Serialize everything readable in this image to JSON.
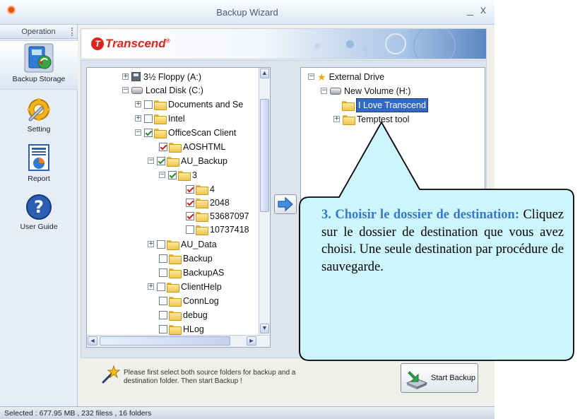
{
  "window": {
    "title": "Backup Wizard",
    "minimize": "_",
    "close": "x"
  },
  "sidebar": {
    "header": "Operation",
    "items": [
      {
        "label": "Backup Storage",
        "icon": "backup-storage-icon"
      },
      {
        "label": "Setting",
        "icon": "wrench-gear-icon"
      },
      {
        "label": "Report",
        "icon": "report-icon"
      },
      {
        "label": "User Guide",
        "icon": "help-icon"
      }
    ]
  },
  "banner": {
    "brand": "Transcend",
    "reg": "®"
  },
  "source_tree": [
    {
      "label": "3½ Floppy (A:)",
      "type": "floppy",
      "expander": "+"
    },
    {
      "label": "Local Disk (C:)",
      "type": "disk",
      "expander": "−"
    },
    {
      "label": "Documents and Se",
      "type": "folder",
      "expander": "+",
      "checked": false
    },
    {
      "label": "Intel",
      "type": "folder",
      "expander": "+",
      "checked": false
    },
    {
      "label": "OfficeScan Client",
      "type": "folder",
      "expander": "−",
      "checked": true
    },
    {
      "label": "AOSHTML",
      "type": "folder",
      "checked": true,
      "check_color": "red"
    },
    {
      "label": "AU_Backup",
      "type": "folder",
      "expander": "−",
      "checked": true
    },
    {
      "label": "3",
      "type": "folder",
      "expander": "−",
      "checked": true
    },
    {
      "label": "4",
      "type": "folder",
      "checked": true,
      "check_color": "red"
    },
    {
      "label": "2048",
      "type": "folder",
      "checked": true,
      "check_color": "red"
    },
    {
      "label": "53687097",
      "type": "folder",
      "checked": true,
      "check_color": "red"
    },
    {
      "label": "10737418",
      "type": "folder",
      "checked": false
    },
    {
      "label": "AU_Data",
      "type": "folder",
      "expander": "+",
      "checked": false
    },
    {
      "label": "Backup",
      "type": "folder",
      "checked": false
    },
    {
      "label": "BackupAS",
      "type": "folder",
      "checked": false
    },
    {
      "label": "ClientHelp",
      "type": "folder",
      "expander": "+",
      "checked": false
    },
    {
      "label": "ConnLog",
      "type": "folder",
      "checked": false
    },
    {
      "label": "debug",
      "type": "folder",
      "checked": false
    },
    {
      "label": "HLog",
      "type": "folder",
      "checked": false
    }
  ],
  "dest_tree": [
    {
      "label": "External Drive",
      "type": "star",
      "expander": "−"
    },
    {
      "label": "New Volume (H:)",
      "type": "disk",
      "expander": "−"
    },
    {
      "label": "I Love Transcend",
      "type": "folder",
      "selected": true
    },
    {
      "label": "Temptest tool",
      "type": "folder",
      "expander": "+"
    }
  ],
  "hint": "Please first select both source folders for backup and a destination folder. Then start Backup !",
  "start_button": "Start Backup",
  "status": "Selected : 677.95 MB , 232 filess , 16 folders",
  "callout": {
    "title": "3. Choisir le dossier de destination:",
    "body": " Cliquez sur le dossier de destination que vous avez choisi. Une seule destination par procédure de sauvegarde."
  },
  "colors": {
    "callout_fill": "#ccf6fb",
    "callout_title": "#3a78c9",
    "selection": "#316ac5",
    "check_red": "#d01c1c"
  }
}
